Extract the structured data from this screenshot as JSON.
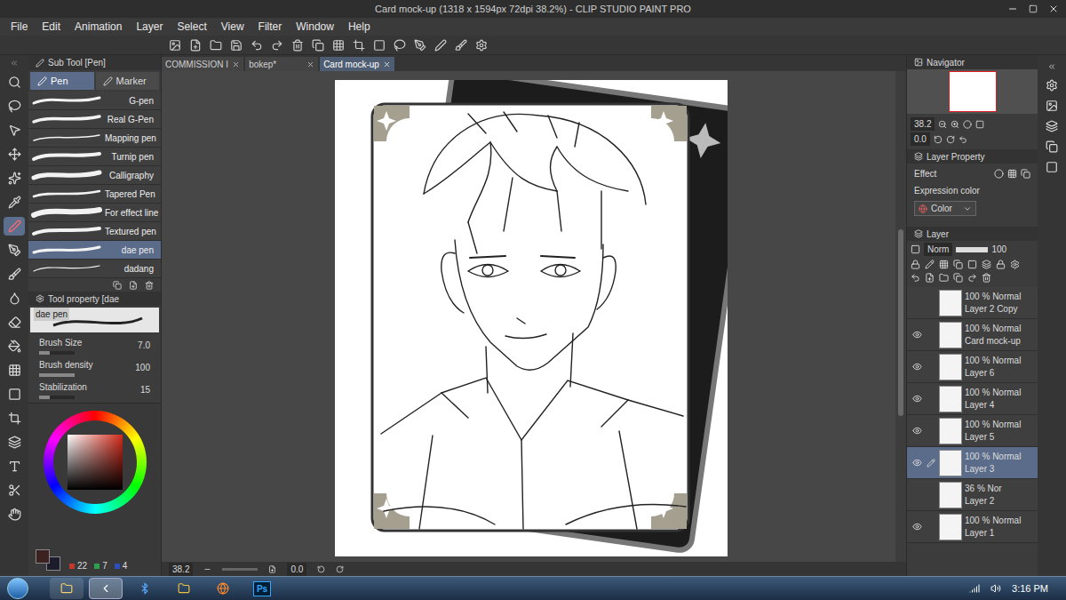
{
  "window": {
    "title": "Card mock-up (1318 x 1594px 72dpi 38.2%)  - CLIP STUDIO PAINT PRO"
  },
  "menu": [
    "File",
    "Edit",
    "Animation",
    "Layer",
    "Select",
    "View",
    "Filter",
    "Window",
    "Help"
  ],
  "tools": [
    {
      "selected": false
    },
    {
      "selected": false
    },
    {
      "selected": false
    },
    {
      "selected": false
    },
    {
      "selected": false
    },
    {
      "selected": false
    },
    {
      "selected": true
    },
    {
      "selected": false
    },
    {
      "selected": false
    },
    {
      "selected": false
    },
    {
      "selected": false
    },
    {
      "selected": false
    },
    {
      "selected": false
    },
    {
      "selected": false
    },
    {
      "selected": false
    },
    {
      "selected": false
    },
    {
      "selected": false
    },
    {
      "selected": false
    },
    {
      "selected": false
    }
  ],
  "document_tabs": [
    {
      "label": "COMMISSION I",
      "selected": false
    },
    {
      "label": "bokep*",
      "selected": false
    },
    {
      "label": "Card mock-up",
      "selected": true
    }
  ],
  "sub_tool": {
    "title": "Sub Tool [Pen]",
    "tabs": [
      {
        "label": "Pen",
        "selected": true
      },
      {
        "label": "Marker",
        "selected": false
      }
    ],
    "items": [
      {
        "label": "G-pen",
        "selected": false
      },
      {
        "label": "Real G-Pen",
        "selected": false
      },
      {
        "label": "Mapping pen",
        "selected": false
      },
      {
        "label": "Turnip pen",
        "selected": false
      },
      {
        "label": "Calligraphy",
        "selected": false
      },
      {
        "label": "Tapered Pen",
        "selected": false
      },
      {
        "label": "For effect line",
        "selected": false
      },
      {
        "label": "Textured pen",
        "selected": false
      },
      {
        "label": "dae pen",
        "selected": true
      },
      {
        "label": "dadang",
        "selected": false
      }
    ]
  },
  "tool_property": {
    "title": "Tool property [dae",
    "preview_label": "dae pen",
    "settings": [
      {
        "label": "Brush Size",
        "value": "7.0",
        "level": 0.3
      },
      {
        "label": "Brush density",
        "value": "100",
        "level": 1
      },
      {
        "label": "Stabilization",
        "value": "15",
        "level": 0.3
      }
    ]
  },
  "color_panel": {
    "hue_color": "#d42a1a",
    "main_color": "#3b2220",
    "sub_color": "#1c1c2c",
    "values": [
      {
        "value": "22",
        "color": "#c0392b"
      },
      {
        "value": "7",
        "color": "#2e9e4f"
      },
      {
        "value": "4",
        "color": "#2a4fc0"
      }
    ]
  },
  "navigator": {
    "title": "Navigator",
    "zoom": "38.2",
    "angle": "0.0"
  },
  "layer_property": {
    "title": "Layer Property",
    "effect_label": "Effect",
    "expression_label": "Expression color",
    "expression_value": "Color"
  },
  "layer_panel": {
    "title": "Layer",
    "blend": "Norm",
    "opacity": "100",
    "layers": [
      {
        "name": "Layer 2 Copy",
        "mode": "100 % Normal",
        "visible": false,
        "selected": false,
        "editing": false
      },
      {
        "name": "Card mock-up",
        "mode": "100 % Normal",
        "visible": true,
        "selected": false,
        "editing": false
      },
      {
        "name": "Layer 6",
        "mode": "100 % Normal",
        "visible": true,
        "selected": false,
        "editing": false
      },
      {
        "name": "Layer 4",
        "mode": "100 % Normal",
        "visible": true,
        "selected": false,
        "editing": false
      },
      {
        "name": "Layer 5",
        "mode": "100 % Normal",
        "visible": true,
        "selected": false,
        "editing": false
      },
      {
        "name": "Layer 3",
        "mode": "100 % Normal",
        "visible": true,
        "selected": true,
        "editing": true
      },
      {
        "name": "Layer 2",
        "mode": "36 % Nor",
        "visible": false,
        "selected": false,
        "editing": false
      },
      {
        "name": "Layer 1",
        "mode": "100 % Normal",
        "visible": true,
        "selected": false,
        "editing": false
      }
    ]
  },
  "status_bar": {
    "zoom": "38.2",
    "angle": "0.0"
  },
  "taskbar": {
    "ps_logo": "Ps",
    "time": "3:16 PM"
  }
}
